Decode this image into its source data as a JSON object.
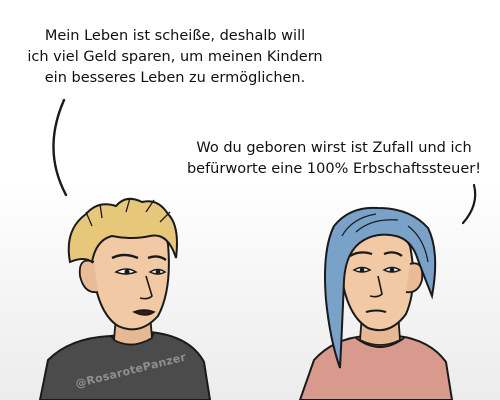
{
  "comic": {
    "speech_left": {
      "lines": [
        "Mein Leben ist scheiße, deshalb will",
        "ich viel Geld sparen, um meinen Kindern",
        "ein besseres Leben zu ermöglichen."
      ]
    },
    "speech_right": {
      "lines": [
        "Wo du geboren wirst ist Zufall und ich",
        "befürworte eine 100% Erbschaftssteuer!"
      ]
    },
    "watermark": "@RosarotePanzer"
  },
  "colors": {
    "left_shirt": "#4b4b4b",
    "left_hair": "#e7c87a",
    "skin": "#f1c9a5",
    "right_shirt": "#d99a8e",
    "right_hair": "#7aa2c8",
    "ink": "#1a1a1a"
  }
}
